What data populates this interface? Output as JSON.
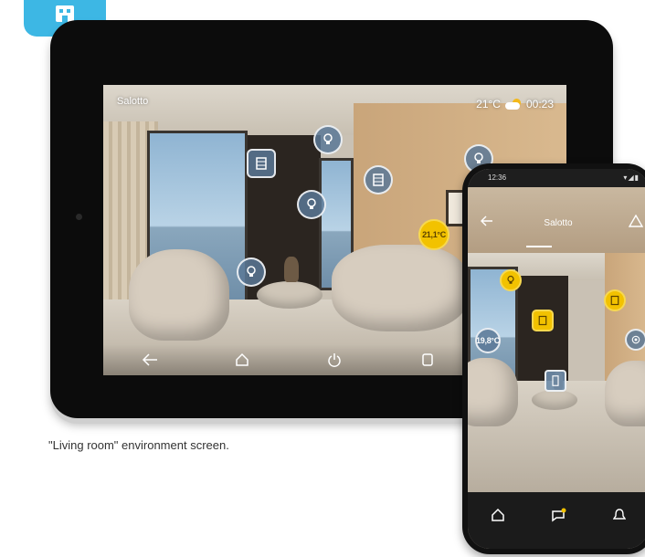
{
  "caption": "\"Living room\" environment screen.",
  "tablet": {
    "room_name": "Salotto",
    "temperature": "21°C",
    "time": "00:23",
    "hotspots": {
      "thermostat": "21,1°C"
    }
  },
  "phone": {
    "status_time": "12:36",
    "title": "Salotto",
    "hotspots": {
      "thermostat": "19,8°C"
    }
  },
  "colors": {
    "badge": "#3db7e4",
    "hotspot_blue": "#5a7896",
    "hotspot_yellow": "#f2c200"
  },
  "icons": [
    "app-badge-icon",
    "weather-icon",
    "light-icon",
    "shutter-icon",
    "thermostat-icon",
    "back-icon",
    "home-icon",
    "power-icon",
    "scenes-icon",
    "messages-icon",
    "alarm-icon",
    "notification-icon",
    "audio-icon"
  ]
}
